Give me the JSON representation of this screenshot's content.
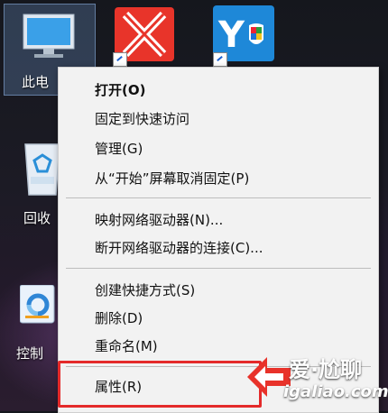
{
  "desktop": {
    "icons": [
      {
        "label": "此电",
        "name": "this-pc"
      },
      {
        "label": "回收",
        "name": "recycle-bin"
      },
      {
        "label": "控制",
        "name": "control-panel"
      }
    ]
  },
  "menu": {
    "items": [
      {
        "label": "打开(O)",
        "bold": true
      },
      {
        "label": "固定到快速访问"
      },
      {
        "label": "管理(G)"
      },
      {
        "label": "从“开始”屏幕取消固定(P)"
      },
      {
        "label": "映射网络驱动器(N)..."
      },
      {
        "label": "断开网络驱动器的连接(C)..."
      },
      {
        "label": "创建快捷方式(S)"
      },
      {
        "label": "删除(D)"
      },
      {
        "label": "重命名(M)"
      },
      {
        "label": "属性(R)"
      }
    ]
  },
  "watermark": {
    "line1": "爱·尬聊",
    "line2": "igaliao.com"
  },
  "colors": {
    "highlight": "#e42a2a",
    "menu_bg": "#f2f2f2"
  }
}
